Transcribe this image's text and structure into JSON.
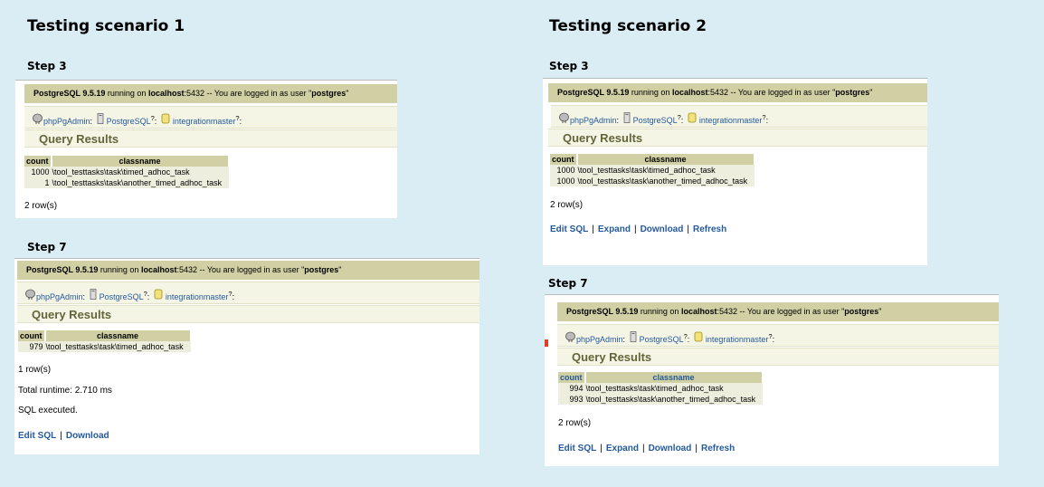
{
  "server_bar": {
    "product": "PostgreSQL 9.5.19",
    "running_on": "running on",
    "host": "localhost",
    "port_text": ":5432 -- You are logged in as user \"",
    "user": "postgres",
    "close_quote": "\""
  },
  "breadcrumb": {
    "app": "phpPgAdmin",
    "server": "PostgreSQL",
    "database": "integrationmaster",
    "sep": ":",
    "sup": "?"
  },
  "query_results_label": "Query Results",
  "columns": {
    "count": "count",
    "classname": "classname"
  },
  "scenarios": [
    {
      "title": "Testing scenario 1",
      "steps": [
        {
          "label": "Step 3",
          "rows": [
            {
              "count": "1000",
              "classname": "\\tool_testtasks\\task\\timed_adhoc_task"
            },
            {
              "count": "1",
              "classname": "\\tool_testtasks\\task\\another_timed_adhoc_task"
            }
          ],
          "row_count": "2 row(s)"
        },
        {
          "label": "Step 7",
          "rows": [
            {
              "count": "979",
              "classname": "\\tool_testtasks\\task\\timed_adhoc_task"
            }
          ],
          "row_count": "1 row(s)",
          "runtime": "Total runtime: 2.710 ms",
          "executed": "SQL executed.",
          "links": [
            "Edit SQL",
            "Download"
          ]
        }
      ]
    },
    {
      "title": "Testing scenario 2",
      "steps": [
        {
          "label": "Step 3",
          "rows": [
            {
              "count": "1000",
              "classname": "\\tool_testtasks\\task\\timed_adhoc_task"
            },
            {
              "count": "1000",
              "classname": "\\tool_testtasks\\task\\another_timed_adhoc_task"
            }
          ],
          "row_count": "2 row(s)",
          "links": [
            "Edit SQL",
            "Expand",
            "Download",
            "Refresh"
          ]
        },
        {
          "label": "Step 7",
          "rows": [
            {
              "count": "994",
              "classname": "\\tool_testtasks\\task\\timed_adhoc_task"
            },
            {
              "count": "993",
              "classname": "\\tool_testtasks\\task\\another_timed_adhoc_task"
            }
          ],
          "row_count": "2 row(s)",
          "links": [
            "Edit SQL",
            "Expand",
            "Download",
            "Refresh"
          ]
        }
      ]
    }
  ],
  "colors": {
    "background": "#daedf5",
    "header_bar": "#d0d0a4",
    "header_light": "#f5f5e6",
    "row_bg": "#eeeede",
    "link": "#24599b",
    "section_title": "#64643a"
  }
}
